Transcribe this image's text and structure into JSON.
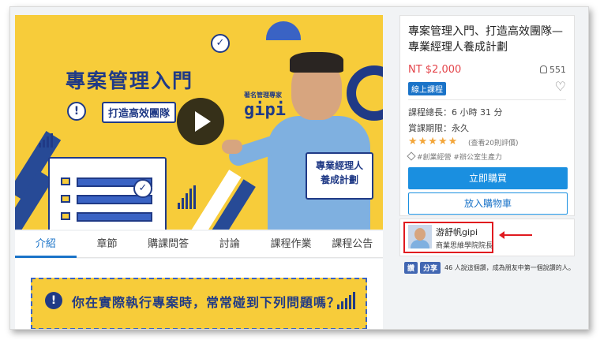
{
  "hero": {
    "title": "專案管理入門",
    "subtitle": "打造高效團隊",
    "expert_label": "著名管理專家",
    "expert_name": "gipi",
    "plan_line1": "專業經理人",
    "plan_line2": "養成計劃",
    "alert_glyph": "!",
    "check_glyph": "✓"
  },
  "tabs": [
    {
      "label": "介紹",
      "active": true
    },
    {
      "label": "章節"
    },
    {
      "label": "購課問答"
    },
    {
      "label": "討論"
    },
    {
      "label": "課程作業"
    },
    {
      "label": "課程公告"
    }
  ],
  "content_banner": {
    "text": "你在實際執行專案時，常常碰到下列問題嗎？",
    "glyph": "!"
  },
  "course": {
    "title": "專案管理入門、打造高效團隊—專業經理人養成計劃",
    "price": "NT $2,000",
    "students": "551",
    "badge": "線上課程",
    "heart_glyph": "♡",
    "length": "課程總長：6 小時 31 分",
    "period": "賞課期限：永久",
    "stars": "★★★★★",
    "rating_text": "(查看20則評價)",
    "tags": "#創業經營 #辦公室生產力",
    "buy_label": "立即購買",
    "cart_label": "放入購物車"
  },
  "instructor": {
    "name": "游舒帆gipi",
    "title": "商業思維學院院長"
  },
  "fb": {
    "like": "讚",
    "share": "分享",
    "text": "46 人說這個讚，成為朋友中第一個說讚的人。"
  },
  "colors": {
    "accent_blue": "#1a8fe0",
    "price_red": "#e4454b",
    "highlight_red": "#e0191f",
    "hero_yellow": "#f7cc3a",
    "hero_navy": "#203a86"
  }
}
